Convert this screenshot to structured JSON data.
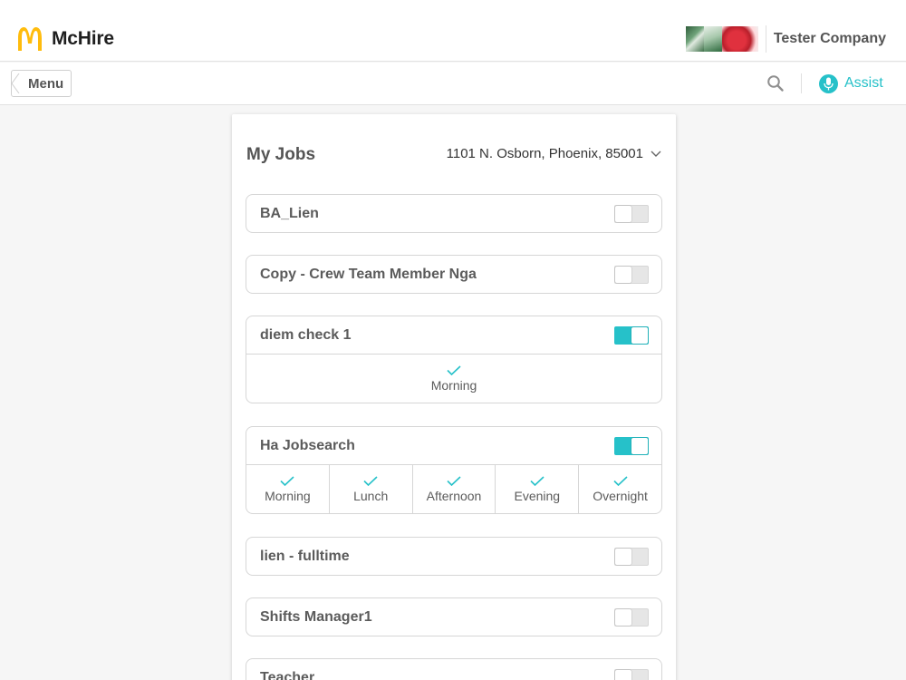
{
  "header": {
    "app_name": "McHire",
    "company_name": "Tester Company"
  },
  "subheader": {
    "menu_label": "Menu",
    "assist_label": "Assist"
  },
  "colors": {
    "accent": "#26c1c9",
    "logo": "#ffbc0d"
  },
  "icons": {
    "search": "search-icon",
    "assist": "microphone-icon",
    "location_dropdown": "chevron-down-icon",
    "shift_selected": "checkmark-icon"
  },
  "card": {
    "title": "My Jobs",
    "location": "1101 N. Osborn, Phoenix, 85001"
  },
  "jobs": [
    {
      "name": "BA_Lien",
      "enabled": false,
      "shifts": []
    },
    {
      "name": "Copy - Crew Team Member Nga",
      "enabled": false,
      "shifts": []
    },
    {
      "name": "diem check 1",
      "enabled": true,
      "shifts": [
        "Morning"
      ]
    },
    {
      "name": "Ha Jobsearch",
      "enabled": true,
      "shifts": [
        "Morning",
        "Lunch",
        "Afternoon",
        "Evening",
        "Overnight"
      ]
    },
    {
      "name": "lien - fulltime",
      "enabled": false,
      "shifts": []
    },
    {
      "name": "Shifts Manager1",
      "enabled": false,
      "shifts": []
    },
    {
      "name": "Teacher",
      "enabled": false,
      "shifts": []
    }
  ]
}
